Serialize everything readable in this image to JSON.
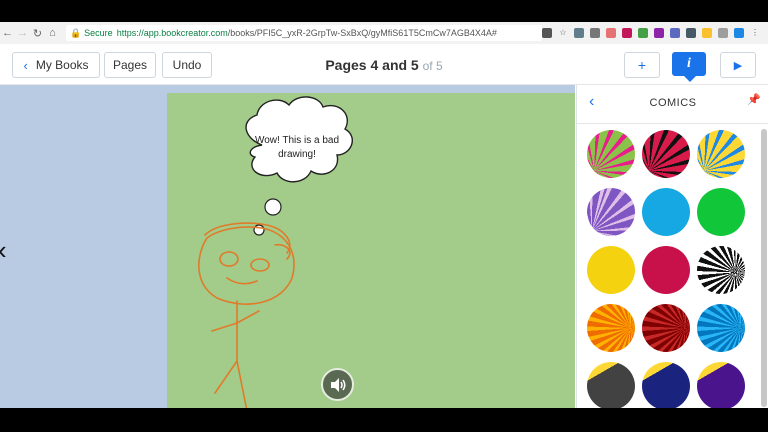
{
  "browser": {
    "secure_label": "Secure",
    "url_host": "https://app.bookcreator.com",
    "url_rest": "/books/PFI5C_yxR-2GrpTw-SxBxQ/gyMfiS61T5CmCw7AGB4X4A#"
  },
  "toolbar": {
    "my_books_label": "My Books",
    "pages_label": "Pages",
    "undo_label": "Undo",
    "page_title": "Pages 4 and 5",
    "page_of": "of 5"
  },
  "canvas": {
    "thought_text_line1": "Wow! This is a bad",
    "thought_text_line2": "drawing!"
  },
  "panel": {
    "title": "COMICS",
    "swatches": [
      {
        "name": "green-pink-burst"
      },
      {
        "name": "red-black-burst"
      },
      {
        "name": "yellow-blue-burst"
      },
      {
        "name": "purple-burst"
      },
      {
        "name": "cyan"
      },
      {
        "name": "green"
      },
      {
        "name": "yellow"
      },
      {
        "name": "crimson"
      },
      {
        "name": "black-white-burst"
      },
      {
        "name": "orange-burst"
      },
      {
        "name": "dark-red-burst"
      },
      {
        "name": "blue-burst"
      },
      {
        "name": "gray-lightning"
      },
      {
        "name": "navy-lightning"
      },
      {
        "name": "violet-lightning"
      }
    ]
  },
  "colors": {
    "accent": "#1a73e8",
    "page_bg": "#a3cb8a",
    "workspace_bg": "#b9cbe3",
    "stroke": "#e07b2a"
  }
}
